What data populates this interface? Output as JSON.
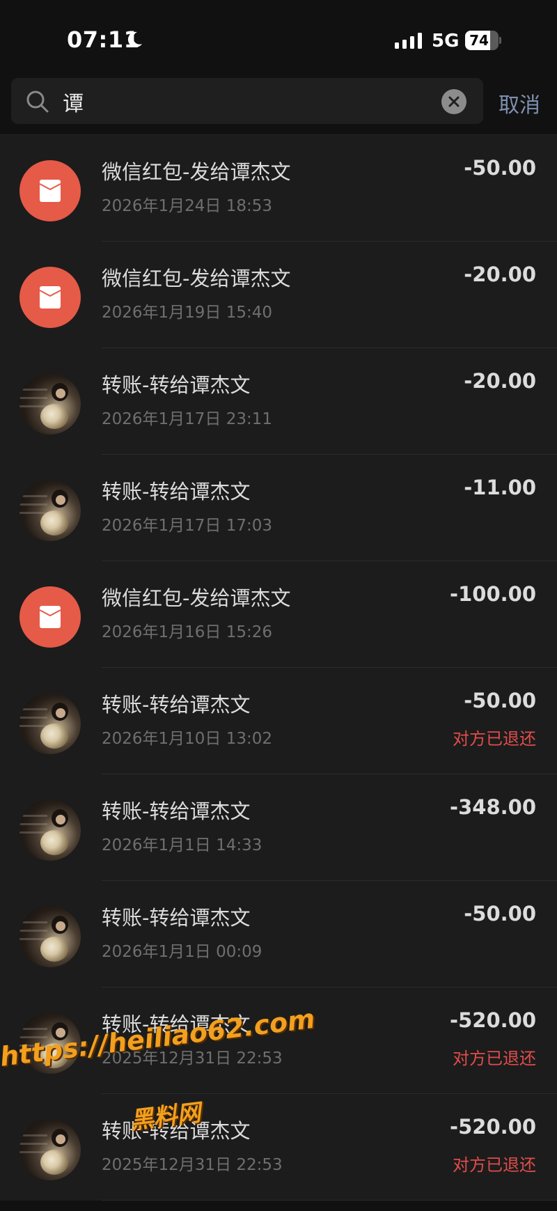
{
  "status_bar": {
    "time": "07:11",
    "network": "5G",
    "battery": "74",
    "battery_level": 0.74
  },
  "search": {
    "query": "谭",
    "cancel_label": "取消"
  },
  "transactions": [
    {
      "title": "微信红包-发给谭杰文",
      "time": "2026年1月24日 18:53",
      "amount": "-50.00",
      "status": "",
      "avatar": "red-packet-icon"
    },
    {
      "title": "微信红包-发给谭杰文",
      "time": "2026年1月19日 15:40",
      "amount": "-20.00",
      "status": "",
      "avatar": "red-packet-icon"
    },
    {
      "title": "转账-转给谭杰文",
      "time": "2026年1月17日 23:11",
      "amount": "-20.00",
      "status": "",
      "avatar": "contact-photo"
    },
    {
      "title": "转账-转给谭杰文",
      "time": "2026年1月17日 17:03",
      "amount": "-11.00",
      "status": "",
      "avatar": "contact-photo"
    },
    {
      "title": "微信红包-发给谭杰文",
      "time": "2026年1月16日 15:26",
      "amount": "-100.00",
      "status": "",
      "avatar": "red-packet-icon"
    },
    {
      "title": "转账-转给谭杰文",
      "time": "2026年1月10日 13:02",
      "amount": "-50.00",
      "status": "对方已退还",
      "avatar": "contact-photo"
    },
    {
      "title": "转账-转给谭杰文",
      "time": "2026年1月1日 14:33",
      "amount": "-348.00",
      "status": "",
      "avatar": "contact-photo"
    },
    {
      "title": "转账-转给谭杰文",
      "time": "2026年1月1日 00:09",
      "amount": "-50.00",
      "status": "",
      "avatar": "contact-photo"
    },
    {
      "title": "转账-转给谭杰文",
      "time": "2025年12月31日 22:53",
      "amount": "-520.00",
      "status": "对方已退还",
      "avatar": "contact-photo"
    },
    {
      "title": "转账-转给谭杰文",
      "time": "2025年12月31日 22:53",
      "amount": "-520.00",
      "status": "对方已退还",
      "avatar": "contact-photo"
    }
  ],
  "watermark": {
    "url": "https://heiliao62.com",
    "name": "黑料网"
  },
  "colors": {
    "background": "#111111",
    "row_background": "#1c1c1c",
    "red_packet": "#e65a48",
    "refund_status": "#e24c4c",
    "cancel_link": "#7d90ad",
    "watermark": "#f2a01e"
  }
}
